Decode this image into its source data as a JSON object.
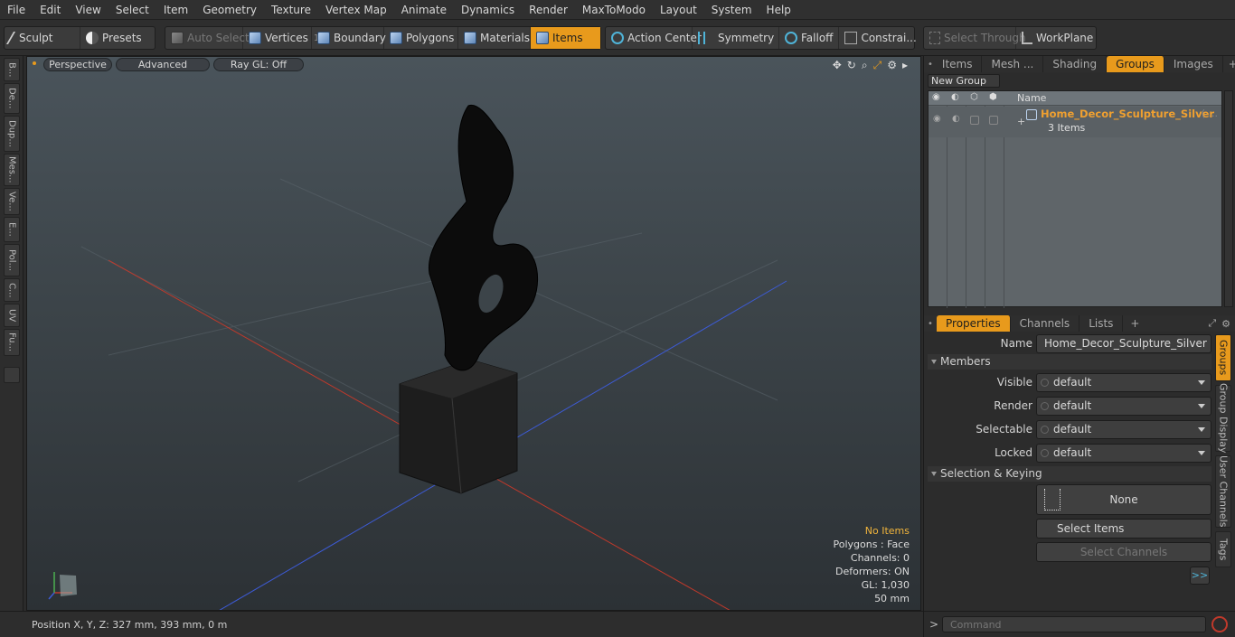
{
  "menu": [
    "File",
    "Edit",
    "View",
    "Select",
    "Item",
    "Geometry",
    "Texture",
    "Vertex Map",
    "Animate",
    "Dynamics",
    "Render",
    "MaxToModo",
    "Layout",
    "System",
    "Help"
  ],
  "toolbar": {
    "sculpt": "Sculpt",
    "presets": "Presets",
    "auto_select": "Auto Select",
    "vertices": "Vertices",
    "vertices_count": "1",
    "boundary": "Boundary",
    "polygons": "Polygons",
    "materials": "Materials",
    "items": "Items",
    "action_center": "Action Center",
    "symmetry": "Symmetry",
    "falloff": "Falloff",
    "constraints": "Constrai...",
    "select_through": "Select Through",
    "workplane": "WorkPlane"
  },
  "left_tabs": [
    "B...",
    "De...",
    "Dup...",
    "Mes...",
    "Ve...",
    "E...",
    "Pol...",
    "C...",
    "UV",
    "Fu..."
  ],
  "viewport": {
    "perspective": "Perspective",
    "advanced": "Advanced",
    "raygl": "Ray GL: Off",
    "stats": {
      "items": "No Items",
      "polygons": "Polygons : Face",
      "channels": "Channels: 0",
      "deformers": "Deformers: ON",
      "gl": "GL: 1,030",
      "scale": "50 mm"
    }
  },
  "statusbar": {
    "position": "Position X, Y, Z:   327 mm, 393 mm, 0 m"
  },
  "groups_panel": {
    "tabs": [
      "Items",
      "Mesh ...",
      "Shading",
      "Groups",
      "Images"
    ],
    "active_tab": "Groups",
    "new_group": "New Group",
    "name_header": "Name",
    "group_name": "Home_Decor_Sculpture_Silver",
    "group_suffix": "( ...",
    "group_count": "3 Items"
  },
  "properties": {
    "tabs": [
      "Properties",
      "Channels",
      "Lists"
    ],
    "name_label": "Name",
    "name_value": "Home_Decor_Sculpture_Silver (3)",
    "members": "Members",
    "visible_label": "Visible",
    "visible_value": "default",
    "render_label": "Render",
    "render_value": "default",
    "selectable_label": "Selectable",
    "selectable_value": "default",
    "locked_label": "Locked",
    "locked_value": "default",
    "selection_keying": "Selection & Keying",
    "none": "None",
    "select_items": "Select Items",
    "select_channels": "Select Channels",
    "more": ">>"
  },
  "right_vtabs": [
    "Groups",
    "Group Display",
    "User Channels",
    "Tags"
  ],
  "command": {
    "placeholder": "Command"
  },
  "colors": {
    "accent": "#e89a1c",
    "x_axis": "#c0392b",
    "z_axis": "#3d5bd6",
    "highlight_text": "#f0b43c"
  }
}
